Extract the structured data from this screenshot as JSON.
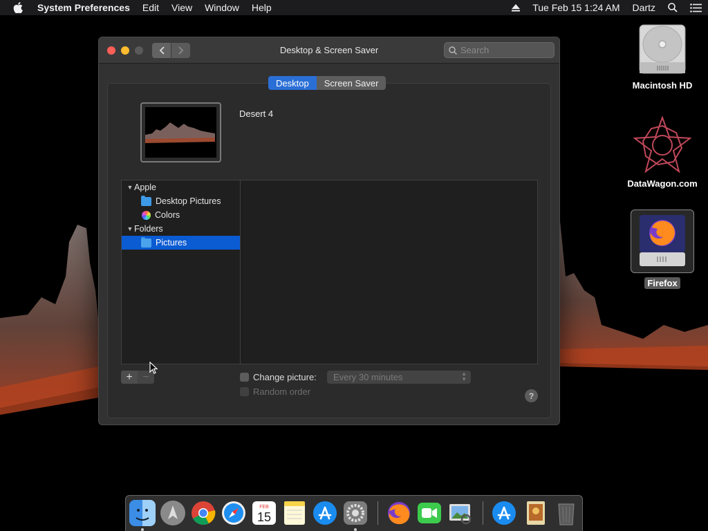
{
  "menubar": {
    "app_name": "System Preferences",
    "menus": [
      "Edit",
      "View",
      "Window",
      "Help"
    ],
    "clock": "Tue Feb 15  1:24 AM",
    "user": "Dartz"
  },
  "desktop_icons": [
    {
      "label": "Macintosh HD"
    },
    {
      "label": "DataWagon.com"
    },
    {
      "label": "Firefox"
    }
  ],
  "window": {
    "title": "Desktop & Screen Saver",
    "search_placeholder": "Search",
    "tabs": [
      {
        "label": "Desktop",
        "selected": true
      },
      {
        "label": "Screen Saver",
        "selected": false
      }
    ],
    "current_picture": "Desert 4",
    "sources": [
      {
        "label": "Apple",
        "type": "group",
        "expanded": true
      },
      {
        "label": "Desktop Pictures",
        "type": "folder"
      },
      {
        "label": "Colors",
        "type": "colors"
      },
      {
        "label": "Folders",
        "type": "group",
        "expanded": true
      },
      {
        "label": "Pictures",
        "type": "folder",
        "selected": true
      }
    ],
    "change_picture_label": "Change picture:",
    "change_picture_checked": false,
    "interval_value": "Every 30 minutes",
    "random_order_label": "Random order",
    "random_order_checked": false,
    "add_label": "+",
    "remove_label": "−",
    "help_label": "?"
  },
  "dock": {
    "apps": [
      "finder-icon",
      "launchpad-icon",
      "chrome-icon",
      "safari-icon",
      "calendar-icon",
      "notes-icon",
      "app-store-icon",
      "system-preferences-icon",
      "firefox-icon",
      "facetime-icon",
      "preview-icon",
      "app-store-download-icon",
      "game-icon",
      "trash-icon"
    ],
    "calendar_month": "FEB",
    "calendar_day": "15"
  },
  "colors": {
    "accent": "#0b5bd3",
    "segment_selected": "#2a6fd6",
    "close": "#fe5f57",
    "minimize": "#febc2e"
  }
}
